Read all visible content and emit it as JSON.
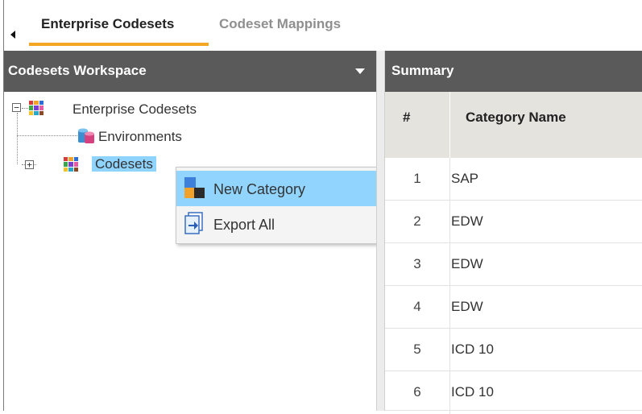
{
  "tabs": [
    {
      "label": "Enterprise Codesets",
      "active": true
    },
    {
      "label": "Codeset Mappings",
      "active": false
    }
  ],
  "workspace": {
    "title": "Codesets Workspace",
    "tree": [
      {
        "label": "Enterprise Codesets",
        "icon": "grid-icon"
      },
      {
        "label": "Environments",
        "icon": "database-icon"
      },
      {
        "label": "Codesets",
        "icon": "grid-icon",
        "selected": true
      }
    ]
  },
  "context_menu": {
    "items": [
      {
        "label": "New Category",
        "icon": "new-category-icon",
        "hover": true
      },
      {
        "label": "Export All",
        "icon": "export-icon"
      }
    ]
  },
  "summary": {
    "title": "Summary",
    "columns": [
      "#",
      "Category Name"
    ],
    "rows": [
      {
        "num": "1",
        "name": "SAP"
      },
      {
        "num": "2",
        "name": "EDW"
      },
      {
        "num": "3",
        "name": "EDW"
      },
      {
        "num": "4",
        "name": "EDW"
      },
      {
        "num": "5",
        "name": "ICD 10"
      },
      {
        "num": "6",
        "name": "ICD 10"
      }
    ]
  },
  "colors": {
    "accent": "#f5a623",
    "header_bg": "#5a5a5a",
    "selection": "#8fd3ff"
  }
}
